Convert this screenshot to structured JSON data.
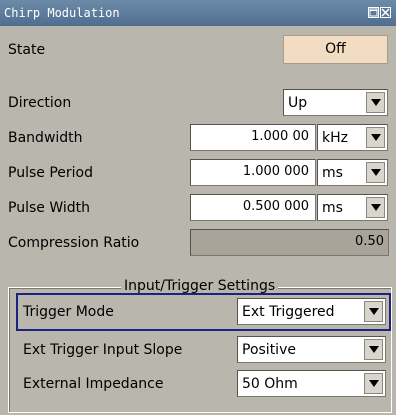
{
  "window": {
    "title": "Chirp Modulation",
    "controls": [
      "restore",
      "close"
    ]
  },
  "state": {
    "label": "State",
    "button": "Off"
  },
  "direction": {
    "label": "Direction",
    "value": "Up"
  },
  "bandwidth": {
    "label": "Bandwidth",
    "value": "1.000 00",
    "unit": "kHz"
  },
  "pulse_period": {
    "label": "Pulse Period",
    "value": "1.000 000",
    "unit": "ms"
  },
  "pulse_width": {
    "label": "Pulse Width",
    "value": "0.500 000",
    "unit": "ms"
  },
  "compression_ratio": {
    "label": "Compression Ratio",
    "value": "0.50"
  },
  "trigger_group": {
    "title": "Input/Trigger Settings",
    "trigger_mode": {
      "label": "Trigger Mode",
      "value": "Ext Triggered"
    },
    "ext_slope": {
      "label": "Ext Trigger Input Slope",
      "value": "Positive"
    },
    "impedance": {
      "label": "External Impedance",
      "value": "50 Ohm"
    }
  },
  "colors": {
    "titlebar": "#5d7c9c",
    "panel": "#b9b6ad",
    "state_button": "#f2dcc2",
    "focus_border": "#1a237e"
  }
}
